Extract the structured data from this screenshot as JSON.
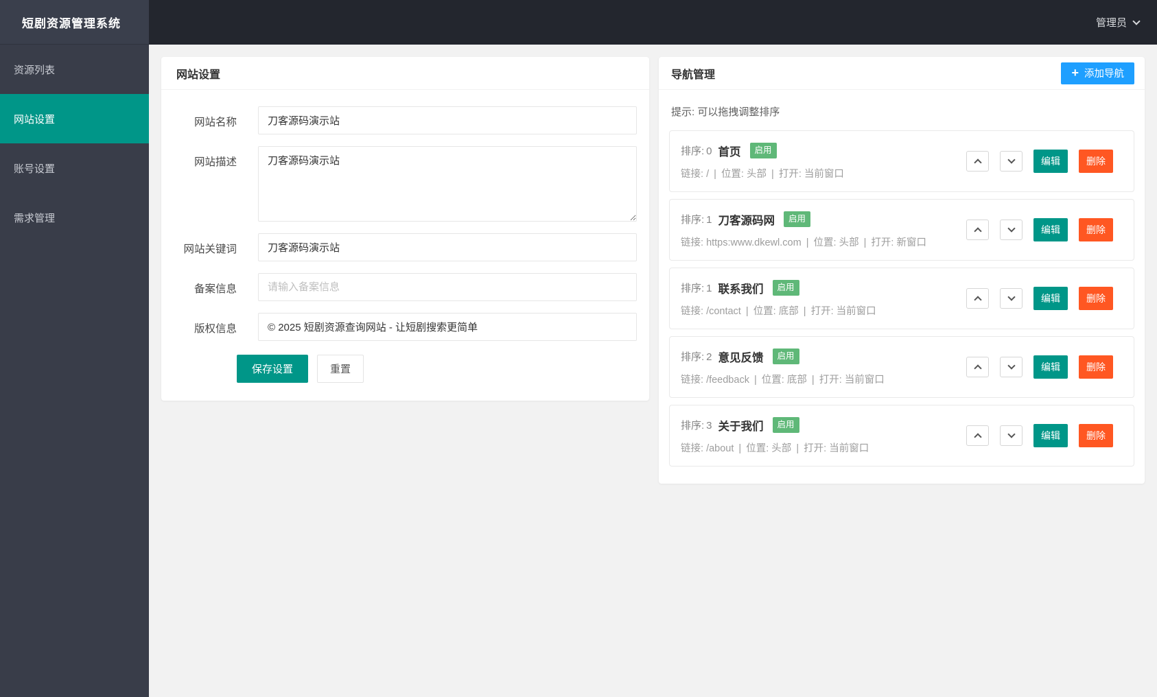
{
  "app": {
    "title": "短剧资源管理系统"
  },
  "topbar": {
    "user": "管理员"
  },
  "sidebar": {
    "items": [
      {
        "label": "资源列表"
      },
      {
        "label": "网站设置"
      },
      {
        "label": "账号设置"
      },
      {
        "label": "需求管理"
      }
    ]
  },
  "site_settings": {
    "title": "网站设置",
    "name": {
      "label": "网站名称",
      "value": "刀客源码演示站"
    },
    "description": {
      "label": "网站描述",
      "value": "刀客源码演示站"
    },
    "keywords": {
      "label": "网站关键词",
      "value": "刀客源码演示站"
    },
    "icp": {
      "label": "备案信息",
      "value": "",
      "placeholder": "请输入备案信息"
    },
    "copyright": {
      "label": "版权信息",
      "value": "© 2025 短剧资源查询网站 - 让短剧搜索更简单"
    },
    "save_label": "保存设置",
    "reset_label": "重置"
  },
  "nav_manage": {
    "title": "导航管理",
    "add_label": "添加导航",
    "hint": "提示: 可以拖拽调整排序",
    "sort_label": "排序:",
    "link_label": "链接:",
    "position_label": "位置:",
    "open_label": "打开:",
    "separator": "|",
    "enabled_label": "启用",
    "edit_label": "编辑",
    "delete_label": "删除",
    "items": [
      {
        "sort": "0",
        "title": "首页",
        "link": "/",
        "position": "头部",
        "open": "当前窗口"
      },
      {
        "sort": "1",
        "title": "刀客源码网",
        "link": "https:www.dkewl.com",
        "position": "头部",
        "open": "新窗口"
      },
      {
        "sort": "1",
        "title": "联系我们",
        "link": "/contact",
        "position": "底部",
        "open": "当前窗口"
      },
      {
        "sort": "2",
        "title": "意见反馈",
        "link": "/feedback",
        "position": "底部",
        "open": "当前窗口"
      },
      {
        "sort": "3",
        "title": "关于我们",
        "link": "/about",
        "position": "头部",
        "open": "当前窗口"
      }
    ]
  },
  "colors": {
    "accent_teal": "#009688",
    "accent_blue": "#1e9fff",
    "accent_red": "#ff5722",
    "badge_green": "#5fb878",
    "sidebar_bg": "#393d49",
    "topbar_bg": "#23262e"
  }
}
